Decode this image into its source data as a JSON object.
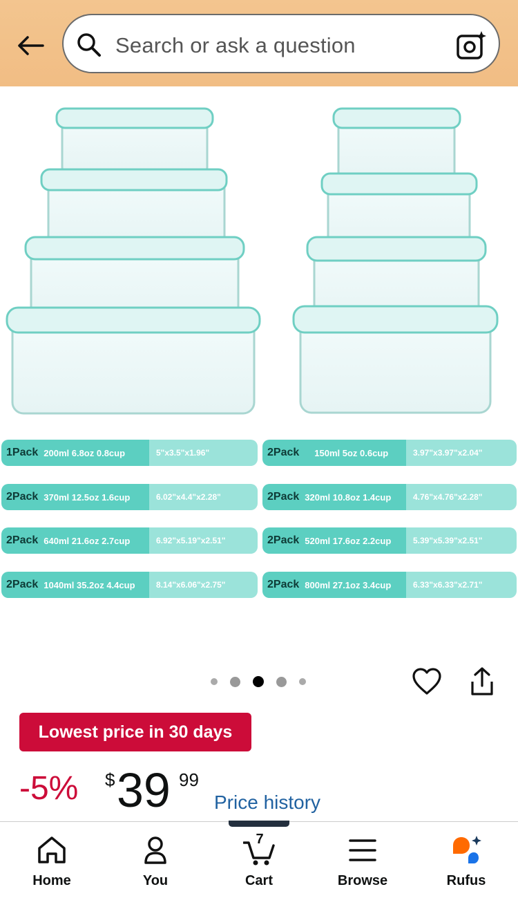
{
  "search": {
    "placeholder": "Search or ask a question"
  },
  "pills": [
    {
      "pack": "1Pack",
      "cap": "200ml 6.8oz  0.8cup",
      "dim": "5\"x3.5\"x1.96\""
    },
    {
      "pack": "2Pack",
      "cap": "150ml 5oz 0.6cup",
      "dim": "3.97\"x3.97\"x2.04\""
    },
    {
      "pack": "2Pack",
      "cap": "370ml 12.5oz 1.6cup",
      "dim": "6.02\"x4.4\"x2.28\""
    },
    {
      "pack": "2Pack",
      "cap": "320ml 10.8oz 1.4cup",
      "dim": "4.76\"x4.76\"x2.28\""
    },
    {
      "pack": "2Pack",
      "cap": "640ml 21.6oz 2.7cup",
      "dim": "6.92\"x5.19\"x2.51\""
    },
    {
      "pack": "2Pack",
      "cap": "520ml 17.6oz 2.2cup",
      "dim": "5.39\"x5.39\"x2.51\""
    },
    {
      "pack": "2Pack",
      "cap": "1040ml 35.2oz 4.4cup",
      "dim": "8.14\"x6.06\"x2.75\""
    },
    {
      "pack": "2Pack",
      "cap": "800ml 27.1oz 3.4cup",
      "dim": "6.33\"x6.33\"x2.71\""
    }
  ],
  "carousel": {
    "count": 5,
    "active": 3
  },
  "badge": "Lowest price in 30 days",
  "price": {
    "discount": "-5%",
    "currency": "$",
    "whole": "39",
    "fraction": "99",
    "history_link": "Price history"
  },
  "cart": {
    "count": "7"
  },
  "nav": [
    {
      "label": "Home",
      "icon": "home-icon"
    },
    {
      "label": "You",
      "icon": "person-icon"
    },
    {
      "label": "Cart",
      "icon": "cart-icon"
    },
    {
      "label": "Browse",
      "icon": "menu-icon"
    },
    {
      "label": "Rufus",
      "icon": "rufus-icon"
    }
  ],
  "colors": {
    "header": "#f3c58f",
    "badge": "#cc0c39",
    "link": "#2162a1",
    "teal": "#5ccfc1",
    "nav_indicator": "#232f3e"
  }
}
